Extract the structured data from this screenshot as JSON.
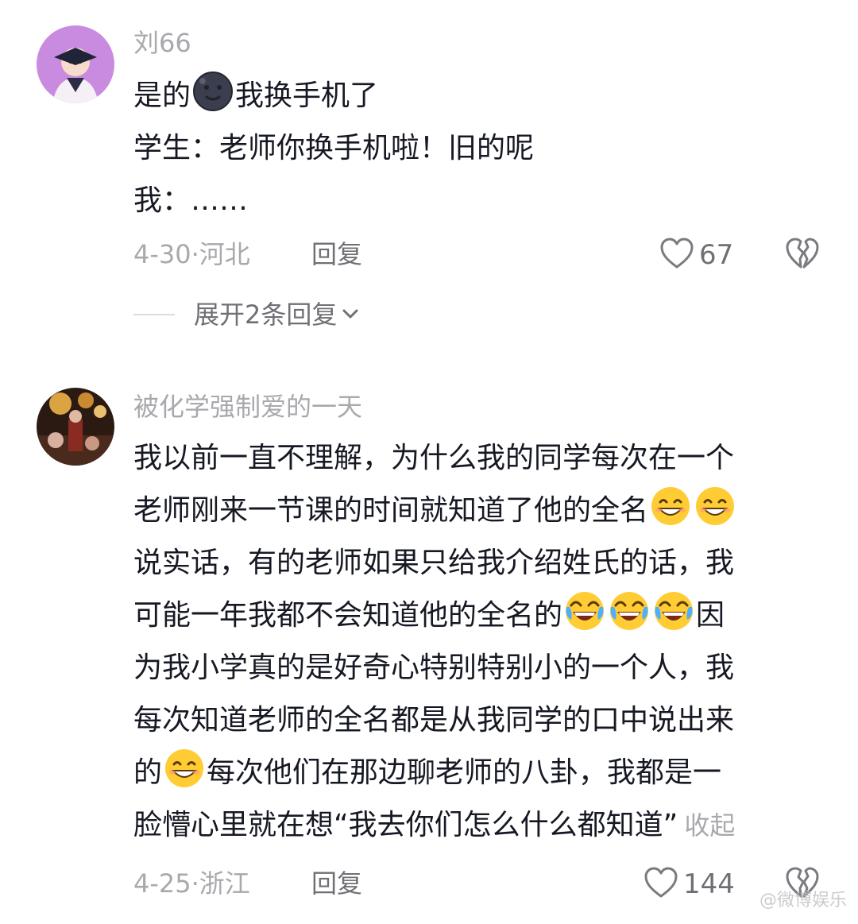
{
  "comments": [
    {
      "username": "刘66",
      "lines": [
        [
          "是的",
          "我换手机了"
        ],
        [
          "学生：老师你换手机啦！旧的呢"
        ],
        [
          "我：……"
        ]
      ],
      "date_location": "4-30·河北",
      "reply_label": "回复",
      "like_count": "67",
      "expand_label": "展开2条回复"
    },
    {
      "username": "被化学强制爱的一天",
      "lines": [
        [
          "我以前一直不理解，为什么我的同学每次在一个"
        ],
        [
          "老师刚来一节课的时间就知道了他的全名"
        ],
        [
          "说实话，有的老师如果只给我介绍姓氏的话，我"
        ],
        [
          "可能一年我都不会知道他的全名的",
          "因"
        ],
        [
          "为我小学真的是好奇心特别特别小的一个人，我"
        ],
        [
          "每次知道老师的全名都是从我同学的口中说出来"
        ],
        [
          "的",
          "每次他们在那边聊老师的八卦，我都是一"
        ],
        [
          "脸懵心里就在想“我去你们怎么什么都知道”"
        ]
      ],
      "collapse_label": "收起",
      "date_location": "4-25·浙江",
      "reply_label": "回复",
      "like_count": "144"
    }
  ],
  "icons": {
    "like": "heart-outline-icon",
    "dislike": "broken-heart-icon",
    "chevron": "chevron-down-icon",
    "emoji_dark": "dark-moon-face-emoji",
    "emoji_grin": "grinning-face-emoji",
    "emoji_laugh": "rolling-laughing-emoji"
  },
  "watermark": "@微博娱乐"
}
